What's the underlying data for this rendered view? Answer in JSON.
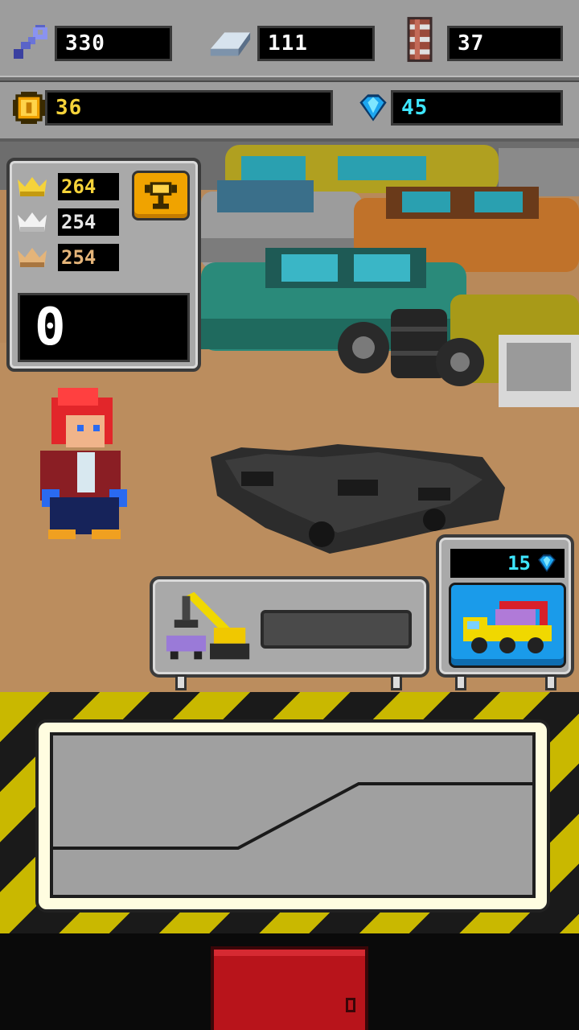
{
  "resources": {
    "wrench": {
      "icon": "wrench-icon",
      "value": "330"
    },
    "metal": {
      "icon": "metal-bar-icon",
      "value": "111"
    },
    "barrel": {
      "icon": "barrel-icon",
      "value": "37"
    },
    "coins": {
      "icon": "coin-icon",
      "value": "36",
      "color": "#f5d33a"
    },
    "gems": {
      "icon": "diamond-icon",
      "value": "45",
      "color": "#3ee6ff"
    }
  },
  "leaderboard": {
    "gold": {
      "icon": "gold-crown-icon",
      "value": "264",
      "color": "#f5d33a"
    },
    "silver": {
      "icon": "silver-crown-icon",
      "value": "254",
      "color": "#e6e6e6"
    },
    "bronze": {
      "icon": "bronze-crown-icon",
      "value": "254",
      "color": "#e4b479"
    },
    "trophy_icon": "trophy-icon"
  },
  "current_score": "0",
  "crusher": {
    "icon": "crane-crusher-icon",
    "progress": 0
  },
  "tow_truck": {
    "price": "15",
    "currency_icon": "diamond-icon",
    "icon": "tow-truck-icon"
  },
  "colors": {
    "accent_yellow": "#f5d33a",
    "gem_cyan": "#3ee6ff",
    "action_red": "#b8141b",
    "tow_blue": "#1a9bea"
  }
}
